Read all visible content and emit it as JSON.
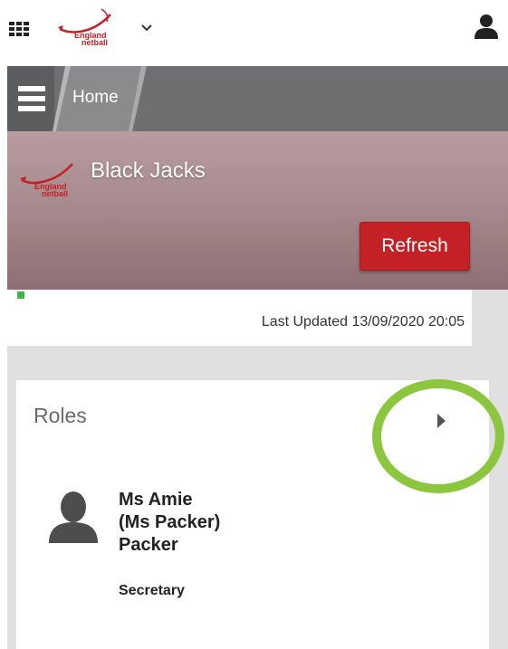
{
  "topbar": {
    "apps_icon": "apps-grid-icon",
    "logo_text": "England netball",
    "chevron_icon": "chevron-down-icon",
    "user_icon": "user-icon"
  },
  "nav": {
    "menu_icon": "hamburger-menu-icon",
    "breadcrumb": "Home"
  },
  "team": {
    "name": "Black Jacks",
    "refresh_label": "Refresh"
  },
  "status": {
    "last_updated": "Last Updated 13/09/2020 20:05"
  },
  "roles": {
    "title": "Roles",
    "arrow_icon": "chevron-right-icon",
    "people": [
      {
        "name": "Ms Amie (Ms Packer) Packer",
        "role": "Secretary"
      }
    ]
  },
  "colors": {
    "accent_red": "#c42126",
    "nav_gray": "#6e6f71",
    "highlight_green": "#8cc63f",
    "status_green": "#3db54a"
  }
}
